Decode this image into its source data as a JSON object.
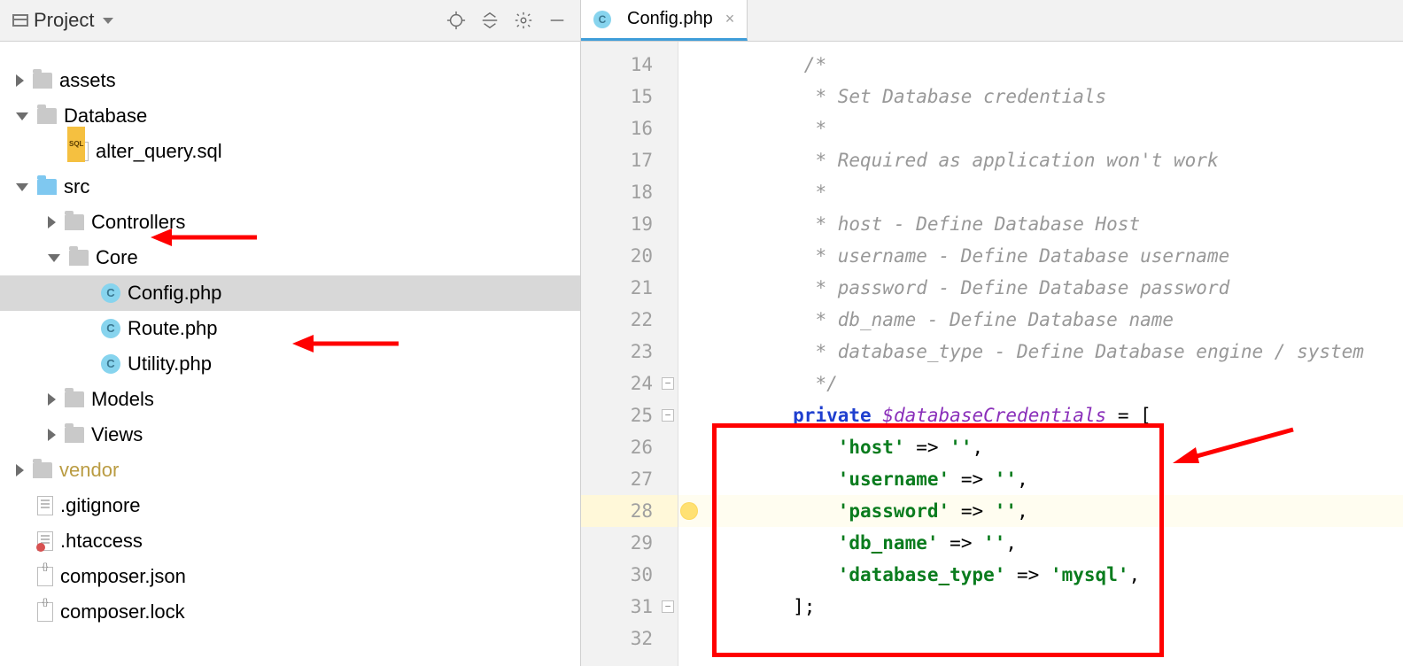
{
  "project": {
    "header_title": "Project",
    "tree": [
      {
        "indent": 0,
        "arrow": "closed",
        "icon": "folder",
        "label": "assets"
      },
      {
        "indent": 0,
        "arrow": "open",
        "icon": "folder",
        "label": "Database"
      },
      {
        "indent": 1,
        "arrow": "none",
        "icon": "sql",
        "label": "alter_query.sql"
      },
      {
        "indent": 0,
        "arrow": "open",
        "icon": "folder-blue",
        "label": "src",
        "annot_arrow": true
      },
      {
        "indent": 1,
        "arrow": "closed",
        "icon": "folder",
        "label": "Controllers"
      },
      {
        "indent": 1,
        "arrow": "open",
        "icon": "folder",
        "label": "Core"
      },
      {
        "indent": 2,
        "arrow": "none",
        "icon": "php-c",
        "label": "Config.php",
        "selected": true,
        "annot_arrow": true
      },
      {
        "indent": 2,
        "arrow": "none",
        "icon": "php-c",
        "label": "Route.php"
      },
      {
        "indent": 2,
        "arrow": "none",
        "icon": "php-c",
        "label": "Utility.php"
      },
      {
        "indent": 1,
        "arrow": "closed",
        "icon": "folder",
        "label": "Models"
      },
      {
        "indent": 1,
        "arrow": "closed",
        "icon": "folder",
        "label": "Views"
      },
      {
        "indent": 0,
        "arrow": "closed",
        "icon": "folder",
        "label": "vendor",
        "label_class": "vendor"
      },
      {
        "indent": 0,
        "arrow": "none",
        "icon": "txt",
        "label": ".gitignore"
      },
      {
        "indent": 0,
        "arrow": "none",
        "icon": "txt red",
        "label": ".htaccess"
      },
      {
        "indent": 0,
        "arrow": "none",
        "icon": "json",
        "label": "composer.json"
      },
      {
        "indent": 0,
        "arrow": "none",
        "icon": "json",
        "label": "composer.lock"
      }
    ]
  },
  "editor": {
    "tab_label": "Config.php",
    "first_line": 14,
    "lines": [
      {
        "n": 14,
        "html": "<span class='c-comment'>/*</span>"
      },
      {
        "n": 15,
        "html": "<span class='c-comment'> * Set Database credentials</span>"
      },
      {
        "n": 16,
        "html": "<span class='c-comment'> *</span>"
      },
      {
        "n": 17,
        "html": "<span class='c-comment'> * Required as application won't work</span>"
      },
      {
        "n": 18,
        "html": "<span class='c-comment'> *</span>"
      },
      {
        "n": 19,
        "html": "<span class='c-comment'> * host - Define Database Host</span>"
      },
      {
        "n": 20,
        "html": "<span class='c-comment'> * username - Define Database username</span>"
      },
      {
        "n": 21,
        "html": "<span class='c-comment'> * password - Define Database password</span>"
      },
      {
        "n": 22,
        "html": "<span class='c-comment'> * db_name - Define Database name</span>"
      },
      {
        "n": 23,
        "html": "<span class='c-comment'> * database_type - Define Database engine / system</span>"
      },
      {
        "n": 24,
        "html": "<span class='c-comment'> */</span>",
        "fold": true
      },
      {
        "n": 25,
        "html": "<span class='c-keyword'>private</span> <span class='c-var'>$databaseCredentials</span> <span class='c-op'>= [</span>",
        "fold": true
      },
      {
        "n": 26,
        "html": "    <span class='c-str'>'host'</span> <span class='c-op'>=&gt;</span> <span class='c-str'>''</span><span class='c-op'>,</span>"
      },
      {
        "n": 27,
        "html": "    <span class='c-str'>'username'</span> <span class='c-op'>=&gt;</span> <span class='c-str'>''</span><span class='c-op'>,</span>"
      },
      {
        "n": 28,
        "html": "    <span class='c-str'>'password'</span> <span class='c-op'>=&gt;</span> <span class='c-str'>''</span><span class='c-op'>,</span>",
        "hl": true,
        "bulb": true
      },
      {
        "n": 29,
        "html": "    <span class='c-str'>'db_name'</span> <span class='c-op'>=&gt;</span> <span class='c-str'>''</span><span class='c-op'>,</span>"
      },
      {
        "n": 30,
        "html": "    <span class='c-str'>'database_type'</span> <span class='c-op'>=&gt;</span> <span class='c-str'>'mysql'</span><span class='c-op'>,</span>"
      },
      {
        "n": 31,
        "html": "<span class='c-op'>];</span>",
        "fold": true
      }
    ],
    "line_offsets": {
      "25": 1
    },
    "code_indent_cols": 2,
    "comment_extra_cols": 1
  }
}
